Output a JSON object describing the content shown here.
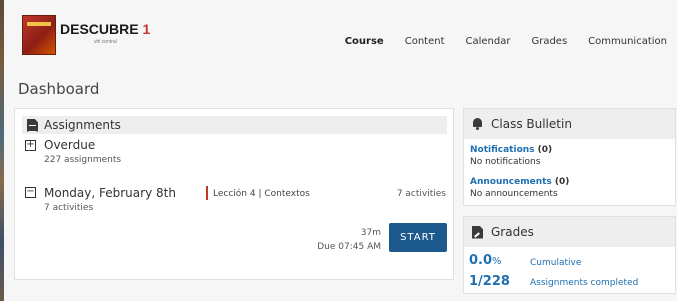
{
  "brand": {
    "title": "DESCUBRE",
    "number": "1",
    "subtitle": "vhl central"
  },
  "nav": {
    "items": [
      "Course",
      "Content",
      "Calendar",
      "Grades",
      "Communication"
    ],
    "active": "Course"
  },
  "page": {
    "title": "Dashboard"
  },
  "assignments": {
    "title": "Assignments",
    "overdue": {
      "label": "Overdue",
      "count_text": "227 assignments",
      "toggle": "+"
    },
    "day": {
      "label": "Monday, February 8th",
      "count_text": "7 activities",
      "toggle": "−",
      "lesson": "Lección 4 | Contextos",
      "lesson_count": "7 activities",
      "duration": "37m",
      "due": "Due 07:45 AM",
      "start_label": "START"
    }
  },
  "bulletin": {
    "title": "Class Bulletin",
    "notifications_label": "Notifications",
    "notifications_count": "(0)",
    "notifications_empty": "No notifications",
    "announcements_label": "Announcements",
    "announcements_count": "(0)",
    "announcements_empty": "No announcements"
  },
  "grades": {
    "title": "Grades",
    "cumulative_value": "0.0",
    "cumulative_unit": "%",
    "cumulative_label": "Cumulative",
    "completed_value": "1/228",
    "completed_label": "Assignments completed"
  },
  "colors": {
    "accent": "#1f6fb2",
    "button": "#1c5a8e",
    "lesson_marker": "#c0392b",
    "panel_header": "#eeeeee"
  }
}
